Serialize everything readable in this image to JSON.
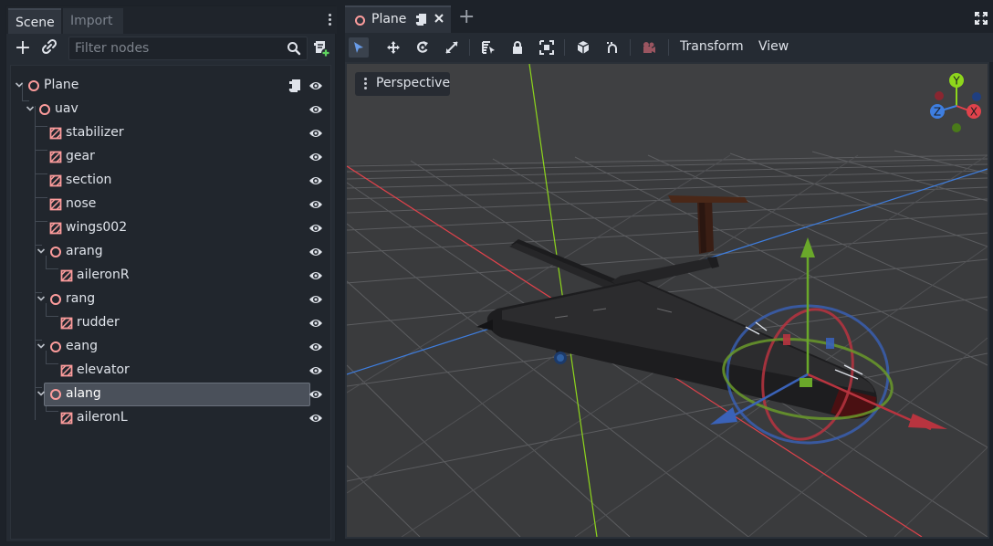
{
  "dock": {
    "tabs": [
      "Scene",
      "Import"
    ],
    "filter_placeholder": "Filter nodes"
  },
  "tree": {
    "nodes": [
      {
        "label": "Plane",
        "type": "spatial",
        "depth": 0,
        "expanded": true,
        "has_script": true
      },
      {
        "label": "uav",
        "type": "spatial",
        "depth": 1,
        "expanded": true
      },
      {
        "label": "stabilizer",
        "type": "mesh",
        "depth": 2
      },
      {
        "label": "gear",
        "type": "mesh",
        "depth": 2
      },
      {
        "label": "section",
        "type": "mesh",
        "depth": 2
      },
      {
        "label": "nose",
        "type": "mesh",
        "depth": 2
      },
      {
        "label": "wings002",
        "type": "mesh",
        "depth": 2
      },
      {
        "label": "arang",
        "type": "spatial",
        "depth": 2,
        "expanded": true
      },
      {
        "label": "aileronR",
        "type": "mesh",
        "depth": 3
      },
      {
        "label": "rang",
        "type": "spatial",
        "depth": 2,
        "expanded": true
      },
      {
        "label": "rudder",
        "type": "mesh",
        "depth": 3
      },
      {
        "label": "eang",
        "type": "spatial",
        "depth": 2,
        "expanded": true
      },
      {
        "label": "elevator",
        "type": "mesh",
        "depth": 3
      },
      {
        "label": "alang",
        "type": "spatial",
        "depth": 2,
        "expanded": true,
        "selected": true
      },
      {
        "label": "aileronL",
        "type": "mesh",
        "depth": 3
      }
    ]
  },
  "editor": {
    "tab_label": "Plane",
    "menus": {
      "transform": "Transform",
      "view": "View"
    },
    "perspective_label": "Perspective",
    "gizmo": {
      "y": "Y",
      "x": "X",
      "z": "Z"
    }
  },
  "colors": {
    "node_icon": "#fc9c9c",
    "accent": "#699ce8",
    "axis_x": "#e0424b",
    "axis_y": "#8ed61c",
    "axis_z": "#3e7ee0"
  }
}
